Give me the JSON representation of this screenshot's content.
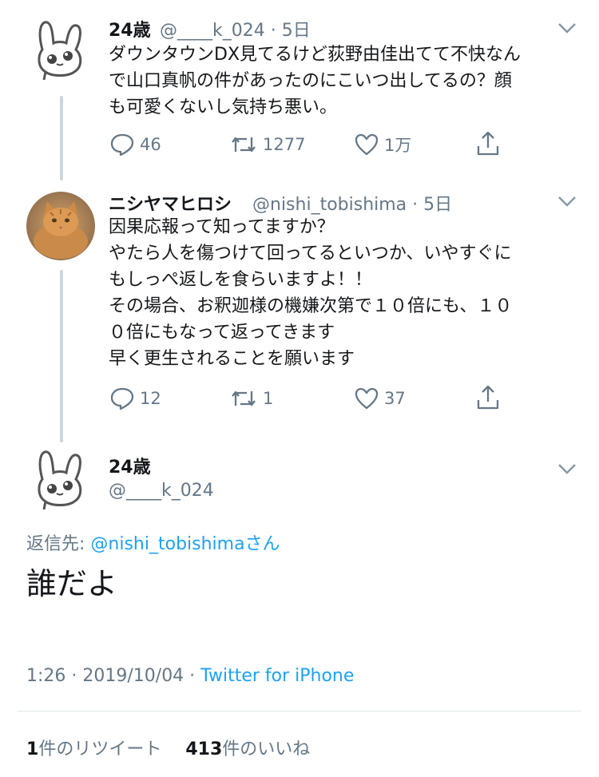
{
  "tweet1": {
    "name": "24歳",
    "handle": "@____k_024",
    "time": "· 5日",
    "text": "ダウンタウンDX見てるけど荻野由佳出てて不快なん\nで山口真帆の件があったのにこいつ出してるの？顔\nも可愛くないし気持ち悪い。",
    "replies": "46",
    "retweets": "1277",
    "likes": "1万"
  },
  "tweet2": {
    "name": "ニシヤマヒロシ",
    "handle": "@nishi_tobishima",
    "time": "· 5日",
    "text": "因果応報って知ってますか？\nやたら人を傷つけて回ってるといつか、いやすぐに\nもしっぺ返しを食らいますよ！！\nその場合、お釈迦様の機嫌次第で１０倍にも、１０\n０倍にもなって返ってきます\n早く更生されることを願います",
    "replies": "12",
    "retweets": "1",
    "likes": "37"
  },
  "main": {
    "name": "24歳",
    "handle": "@____k_024",
    "reply_prefix": "返信先: ",
    "reply_to": "@nishi_tobishima",
    "reply_suffix": "さん",
    "text": "誰だよ",
    "timestamp": "1:26 · 2019/10/04 · ",
    "client": "Twitter for iPhone",
    "retweet_count": "1",
    "retweet_label": "件のリツイート",
    "like_count": "413",
    "like_label": "件のいいね"
  },
  "colors": {
    "link": "#1da1f2",
    "secondary": "#657786",
    "line": "#ccd6dd"
  }
}
